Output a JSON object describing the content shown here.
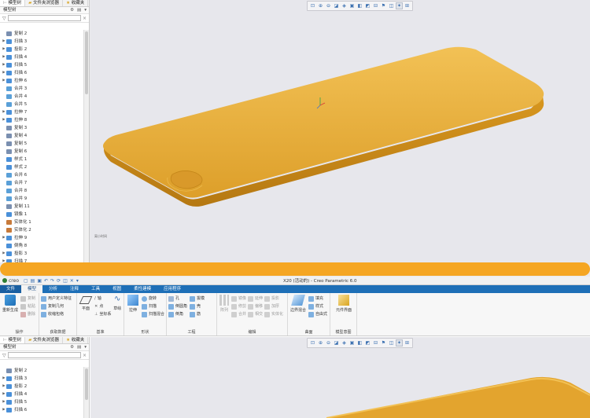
{
  "top": {
    "panel_tabs": [
      "模型树",
      "文件夹浏览器",
      "收藏夹"
    ],
    "tree_header": "模型树",
    "tree_items": [
      {
        "label": "复制 2",
        "expand": false,
        "color": "#7a8fb0"
      },
      {
        "label": "扫描 3",
        "expand": true,
        "color": "#4a90d9"
      },
      {
        "label": "投影 2",
        "expand": true,
        "color": "#4a90d9"
      },
      {
        "label": "扫描 4",
        "expand": true,
        "color": "#4a90d9"
      },
      {
        "label": "扫描 5",
        "expand": true,
        "color": "#4a90d9"
      },
      {
        "label": "扫描 6",
        "expand": true,
        "color": "#4a90d9"
      },
      {
        "label": "拉伸 6",
        "expand": true,
        "color": "#4a90d9"
      },
      {
        "label": "合并 3",
        "expand": false,
        "color": "#5aa0d8"
      },
      {
        "label": "合并 4",
        "expand": false,
        "color": "#5aa0d8"
      },
      {
        "label": "合并 5",
        "expand": false,
        "color": "#5aa0d8"
      },
      {
        "label": "拉伸 7",
        "expand": true,
        "color": "#4a90d9"
      },
      {
        "label": "拉伸 8",
        "expand": true,
        "color": "#4a90d9"
      },
      {
        "label": "复制 3",
        "expand": false,
        "color": "#7a8fb0"
      },
      {
        "label": "复制 4",
        "expand": false,
        "color": "#7a8fb0"
      },
      {
        "label": "复制 5",
        "expand": false,
        "color": "#7a8fb0"
      },
      {
        "label": "复制 6",
        "expand": false,
        "color": "#7a8fb0"
      },
      {
        "label": "样式 1",
        "expand": false,
        "color": "#4a90d9"
      },
      {
        "label": "样式 2",
        "expand": false,
        "color": "#4a90d9"
      },
      {
        "label": "合并 6",
        "expand": false,
        "color": "#5aa0d8"
      },
      {
        "label": "合并 7",
        "expand": false,
        "color": "#5aa0d8"
      },
      {
        "label": "合并 8",
        "expand": false,
        "color": "#5aa0d8"
      },
      {
        "label": "合并 9",
        "expand": false,
        "color": "#5aa0d8"
      },
      {
        "label": "复制 11",
        "expand": false,
        "color": "#7a8fb0"
      },
      {
        "label": "镜像 1",
        "expand": false,
        "color": "#4a90d9"
      },
      {
        "label": "实体化 1",
        "expand": false,
        "color": "#c77a3a"
      },
      {
        "label": "实体化 2",
        "expand": false,
        "color": "#c77a3a"
      },
      {
        "label": "拉伸 9",
        "expand": true,
        "color": "#4a90d9"
      },
      {
        "label": "倒角 8",
        "expand": false,
        "color": "#4a90d9"
      },
      {
        "label": "投影 3",
        "expand": true,
        "color": "#4a90d9"
      },
      {
        "label": "扫描 7",
        "expand": true,
        "color": "#4a90d9"
      }
    ],
    "viewport_note": "离小时间"
  },
  "bottom": {
    "window_title": "X20 (活动的) - Creo Parametric 6.0",
    "logo": "creo",
    "menu_tabs": [
      "文件",
      "模型",
      "分析",
      "注释",
      "工具",
      "视图",
      "柔性建模",
      "应用程序"
    ],
    "ribbon": {
      "ops": {
        "big": "重新生成",
        "items": [
          "复制",
          "粘贴",
          "删除"
        ],
        "label": "操作"
      },
      "getdata": {
        "items": [
          "用户定义特征",
          "复制几何",
          "收缩包络"
        ],
        "label": "获取数据"
      },
      "datum": {
        "big": "平面",
        "items": [
          "轴",
          "点",
          "坐标系"
        ],
        "extra": "草绘",
        "label": "基准"
      },
      "shapes": {
        "big": "拉伸",
        "items": [
          "旋转",
          "扫描",
          "扫描混合"
        ],
        "label": "形状"
      },
      "eng": {
        "items": [
          "孔",
          "倒圆角",
          "倒角",
          "拔模",
          "壳",
          "筋"
        ],
        "label": "工程"
      },
      "edit": {
        "big": "阵列",
        "items": [
          "镜像",
          "修剪",
          "合并",
          "延伸",
          "偏移",
          "相交",
          "投影",
          "加厚",
          "实体化"
        ],
        "label": "编辑"
      },
      "surf": {
        "big": "边界混合",
        "items": [
          "填充",
          "样式",
          "自由式"
        ],
        "label": "曲面"
      },
      "intent": {
        "big": "元件界面",
        "label": "模型意图"
      }
    },
    "panel_tabs": [
      "模型树",
      "文件夹浏览器",
      "收藏夹"
    ],
    "tree_header": "模型树",
    "tree_items": [
      {
        "label": "复制 2",
        "expand": false,
        "color": "#7a8fb0"
      },
      {
        "label": "扫描 3",
        "expand": true,
        "color": "#4a90d9"
      },
      {
        "label": "投影 2",
        "expand": true,
        "color": "#4a90d9"
      },
      {
        "label": "扫描 4",
        "expand": true,
        "color": "#4a90d9"
      },
      {
        "label": "扫描 5",
        "expand": true,
        "color": "#4a90d9"
      },
      {
        "label": "扫描 6",
        "expand": true,
        "color": "#4a90d9"
      }
    ]
  },
  "colors": {
    "model": "#e3a42e",
    "model_dark": "#c8891c",
    "model_light": "#f0bd4c",
    "divider": "#f5a623",
    "ribbon_blue": "#1e6fb7"
  }
}
